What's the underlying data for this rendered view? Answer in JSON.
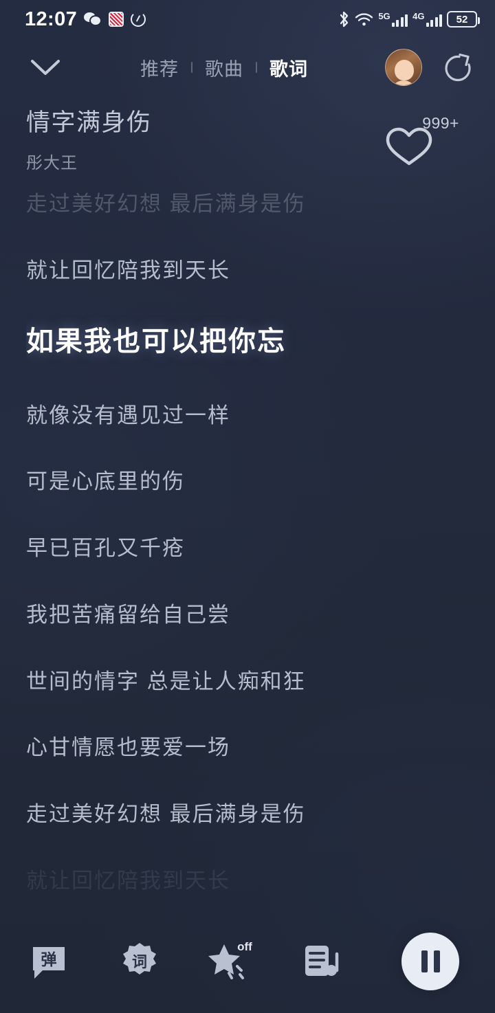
{
  "theme": {
    "bg": "#232b40",
    "accent_text": "#ffffff",
    "muted_text": "#9aa3b6",
    "lyric_text": "#b6bdcc"
  },
  "status_bar": {
    "time": "12:07",
    "left_icons": [
      "wechat-icon",
      "red-app-icon",
      "speedometer-icon"
    ],
    "right_icons": [
      "bluetooth-icon",
      "wifi-icon",
      "signal-5g-icon",
      "signal-4g-icon"
    ],
    "network_5g_label": "5G",
    "network_4g_label": "4G",
    "battery_level": "52"
  },
  "top_nav": {
    "collapse_icon": "chevron-down-icon",
    "tabs": [
      {
        "label": "推荐",
        "active": false
      },
      {
        "label": "歌曲",
        "active": false
      },
      {
        "label": "歌词",
        "active": true
      }
    ],
    "avatar": "user-avatar",
    "share_icon": "share-icon"
  },
  "song": {
    "title": "情字满身伤",
    "artist": "彤大王",
    "like_icon": "heart-icon",
    "like_count": "999+"
  },
  "lyrics": {
    "lines": [
      {
        "text": "走过美好幻想 最后满身是伤",
        "state": "fade-top"
      },
      {
        "text": "就让回忆陪我到天长",
        "state": "normal"
      },
      {
        "text": "如果我也可以把你忘",
        "state": "active"
      },
      {
        "text": "就像没有遇见过一样",
        "state": "normal"
      },
      {
        "text": "可是心底里的伤",
        "state": "normal"
      },
      {
        "text": "早已百孔又千疮",
        "state": "normal"
      },
      {
        "text": "我把苦痛留给自己尝",
        "state": "normal"
      },
      {
        "text": "世间的情字 总是让人痴和狂",
        "state": "normal"
      },
      {
        "text": "心甘情愿也要爱一场",
        "state": "normal"
      },
      {
        "text": "走过美好幻想 最后满身是伤",
        "state": "normal"
      },
      {
        "text": "就让回忆陪我到天长",
        "state": "fade-bottom"
      }
    ]
  },
  "bottom_bar": {
    "tools": [
      {
        "name": "danmaku-button",
        "label": "弹"
      },
      {
        "name": "lyrics-button",
        "label": "词"
      },
      {
        "name": "effects-button",
        "label": "off"
      },
      {
        "name": "playlist-button",
        "label": ""
      }
    ],
    "play_control": "pause-button"
  }
}
